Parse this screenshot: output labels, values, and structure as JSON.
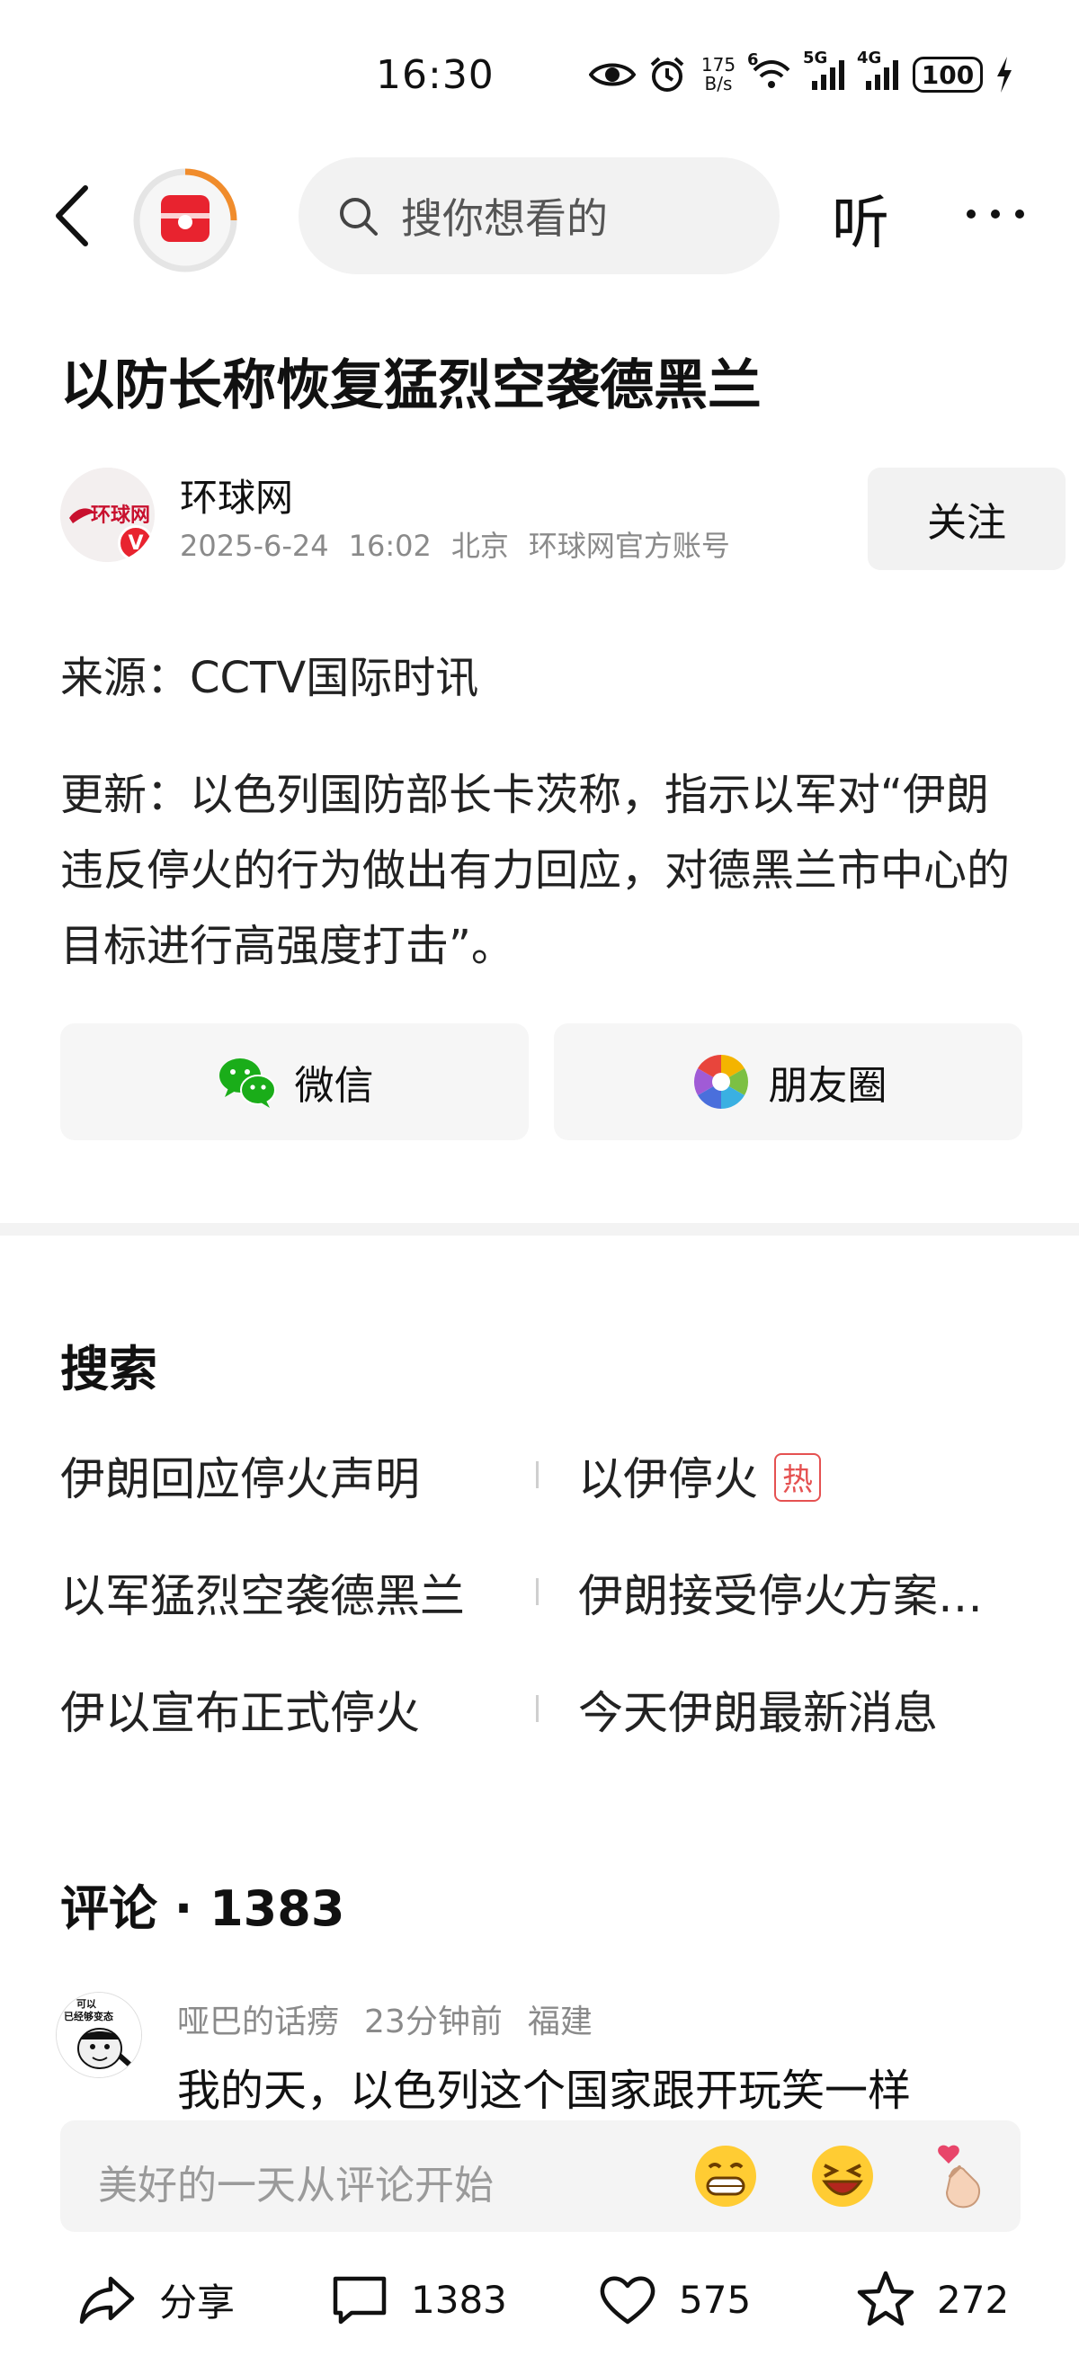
{
  "status_bar": {
    "time": "16:30",
    "net_speed_value": "175",
    "net_speed_unit": "B/s",
    "wifi_badge": "6",
    "signal1_label": "5G",
    "signal2_label": "4G",
    "battery": "100"
  },
  "nav": {
    "search_placeholder": "搜你想看的",
    "listen_label": "听"
  },
  "article": {
    "title": "以防长称恢复猛烈空袭德黑兰",
    "author": {
      "name": "环球网",
      "avatar_text": "环球网",
      "verified_badge": "V",
      "date": "2025-6-24",
      "time": "16:02",
      "location": "北京",
      "account_type": "环球网官方账号",
      "follow_label": "关注"
    },
    "source": "来源：CCTV国际时讯",
    "update": "更新：以色列国防部长卡茨称，指示以军对“伊朗违反停火的行为做出有力回应，对德黑兰市中心的目标进行高强度打击”。"
  },
  "share": {
    "wechat_label": "微信",
    "moments_label": "朋友圈"
  },
  "search_section": {
    "title": "搜索",
    "hot_badge": "热",
    "items": [
      {
        "left": "伊朗回应停火声明",
        "right": "以伊停火"
      },
      {
        "left": "以军猛烈空袭德黑兰",
        "right": "伊朗接受停火方案…"
      },
      {
        "left": "伊以宣布正式停火",
        "right": "今天伊朗最新消息"
      }
    ]
  },
  "comments": {
    "title": "评论 · 1383",
    "first": {
      "user": "哑巴的话痨",
      "time": "23分钟前",
      "location": "福建",
      "text": "我的天，以色列这个国家跟开玩笑一样",
      "avatar_text_1": "可以",
      "avatar_text_2": "已经够变态"
    },
    "input_placeholder": "美好的一天从评论开始"
  },
  "actions": {
    "share_label": "分享",
    "comment_count": "1383",
    "like_count": "575",
    "favorite_count": "272"
  },
  "colors": {
    "brand_red": "#e8232f",
    "wechat_green": "#1aad19",
    "hot_red": "#e55151"
  }
}
